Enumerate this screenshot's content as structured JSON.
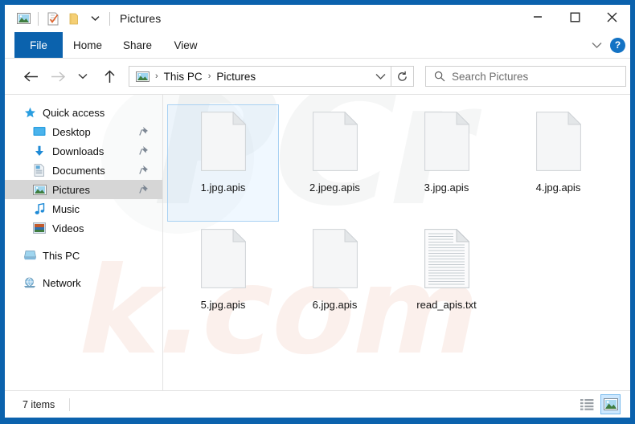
{
  "window": {
    "title": "Pictures",
    "accent_color": "#0b62ad",
    "border_color": "#0b62ad",
    "quick_access": [
      {
        "name": "pictures-icon",
        "label": "Pictures"
      },
      {
        "name": "properties-icon",
        "label": "Properties"
      },
      {
        "name": "new-folder-icon",
        "label": "New folder"
      },
      {
        "name": "customize-dropdown-icon",
        "label": "Customize Quick Access Toolbar"
      }
    ],
    "controls": [
      {
        "name": "minimize-button",
        "glyph": "—",
        "label": "Minimize"
      },
      {
        "name": "maximize-button",
        "glyph": "□",
        "label": "Maximize"
      },
      {
        "name": "close-button",
        "glyph": "✕",
        "label": "Close"
      }
    ]
  },
  "ribbon": {
    "tabs": [
      {
        "label": "File",
        "selected": true
      },
      {
        "label": "Home",
        "selected": false
      },
      {
        "label": "Share",
        "selected": false
      },
      {
        "label": "View",
        "selected": false
      }
    ],
    "expand_label": "∨",
    "help_label": "?"
  },
  "address": {
    "back_label": "Back",
    "forward_label": "Forward",
    "recent_label": "Recent locations",
    "up_label": "Up",
    "breadcrumb": [
      {
        "label": "This PC"
      },
      {
        "label": "Pictures"
      }
    ],
    "separator": "›",
    "dropdown_label": "Previous locations",
    "refresh_label": "Refresh"
  },
  "search": {
    "placeholder": "Search Pictures",
    "icon": "search-icon"
  },
  "sidebar": {
    "items": [
      {
        "label": "Quick access",
        "icon": "star-icon",
        "indent": false,
        "pinned": false,
        "selected": false,
        "gap_before": false
      },
      {
        "label": "Desktop",
        "icon": "desktop-icon",
        "indent": true,
        "pinned": true,
        "selected": false,
        "gap_before": false
      },
      {
        "label": "Downloads",
        "icon": "download-icon",
        "indent": true,
        "pinned": true,
        "selected": false,
        "gap_before": false
      },
      {
        "label": "Documents",
        "icon": "document-icon",
        "indent": true,
        "pinned": true,
        "selected": false,
        "gap_before": false
      },
      {
        "label": "Pictures",
        "icon": "pictures-icon",
        "indent": true,
        "pinned": true,
        "selected": true,
        "gap_before": false
      },
      {
        "label": "Music",
        "icon": "music-icon",
        "indent": true,
        "pinned": false,
        "selected": false,
        "gap_before": false
      },
      {
        "label": "Videos",
        "icon": "videos-icon",
        "indent": true,
        "pinned": false,
        "selected": false,
        "gap_before": false
      },
      {
        "label": "This PC",
        "icon": "this-pc-icon",
        "indent": false,
        "pinned": false,
        "selected": false,
        "gap_before": true
      },
      {
        "label": "Network",
        "icon": "network-icon",
        "indent": false,
        "pinned": false,
        "selected": false,
        "gap_before": true
      }
    ]
  },
  "files": [
    {
      "name": "1.jpg.apis",
      "type": "blank-file",
      "selected": true
    },
    {
      "name": "2.jpeg.apis",
      "type": "blank-file",
      "selected": false
    },
    {
      "name": "3.jpg.apis",
      "type": "blank-file",
      "selected": false
    },
    {
      "name": "4.jpg.apis",
      "type": "blank-file",
      "selected": false
    },
    {
      "name": "5.jpg.apis",
      "type": "blank-file",
      "selected": false
    },
    {
      "name": "6.jpg.apis",
      "type": "blank-file",
      "selected": false
    },
    {
      "name": "read_apis.txt",
      "type": "text-file",
      "selected": false
    }
  ],
  "status": {
    "item_count": "7 items",
    "views": [
      {
        "name": "details-view-button",
        "label": "Details view",
        "active": false
      },
      {
        "name": "large-icons-view-button",
        "label": "Large icons view",
        "active": true
      }
    ]
  },
  "watermark": {
    "grey_text": "PCr",
    "red_text": "k.com"
  }
}
